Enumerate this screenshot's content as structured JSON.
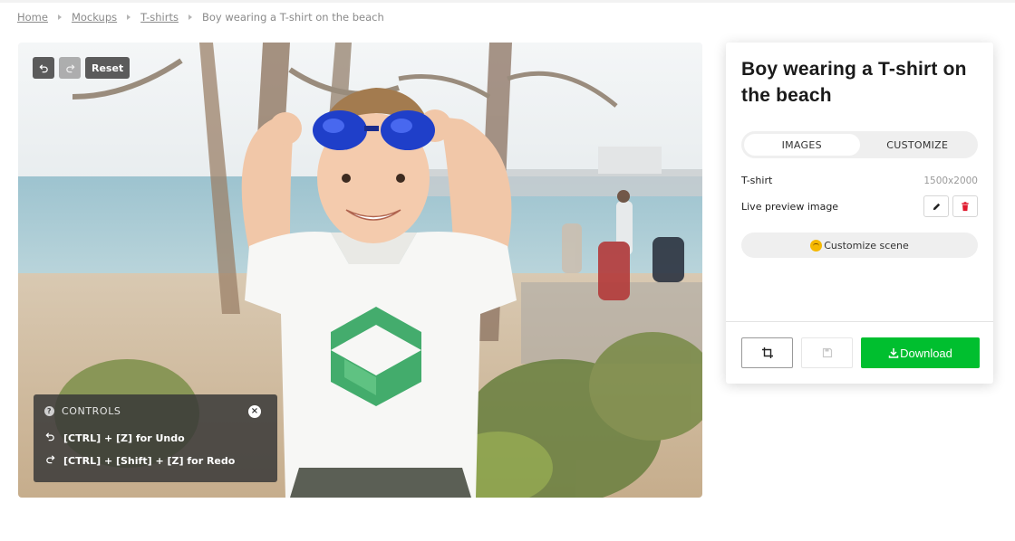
{
  "breadcrumb": {
    "items": [
      "Home",
      "Mockups",
      "T-shirts"
    ],
    "current": "Boy wearing a T-shirt on the beach"
  },
  "canvas": {
    "image_description_icon": "photo-of-boy-in-white-tshirt-on-beach",
    "toolbar": {
      "undo_icon": "undo-icon",
      "redo_icon": "redo-icon",
      "reset_label": "Reset"
    },
    "controls": {
      "heading": "CONTROLS",
      "close_glyph": "×",
      "undo_hint": "[CTRL] + [Z] for Undo",
      "redo_hint": "[CTRL] + [Shift] + [Z] for Redo"
    }
  },
  "panel": {
    "title": "Boy wearing a T-shirt on the beach",
    "tabs": [
      {
        "label": "IMAGES",
        "active": true
      },
      {
        "label": "CUSTOMIZE",
        "active": false
      }
    ],
    "tshirt_label": "T-shirt",
    "tshirt_size": "1500x2000",
    "live_preview_label": "Live preview image",
    "customize_scene_label": "Customize scene",
    "download_label": "Download"
  },
  "colors": {
    "accent_green": "#00bf2f",
    "delete_red": "#e0182d",
    "logo_green": "#3aa865"
  }
}
